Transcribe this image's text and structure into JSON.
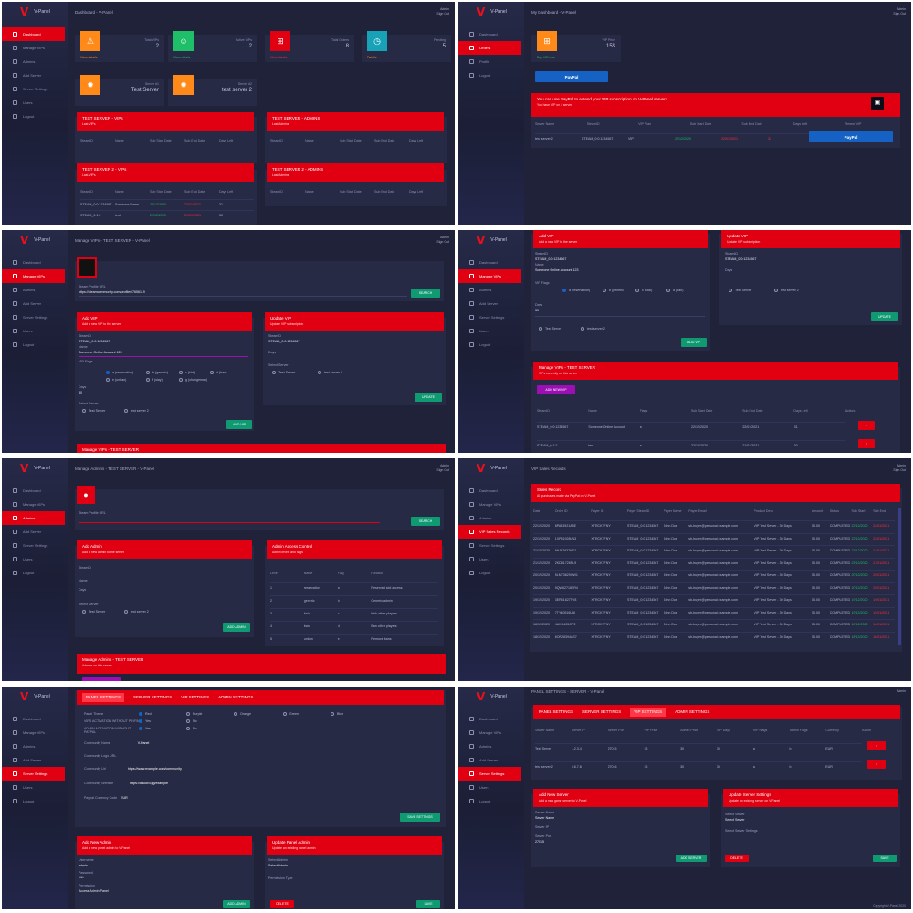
{
  "app": {
    "brand": "V-Panel",
    "user_top": "Admin",
    "user_bottom": "Sign Out"
  },
  "colors": {
    "accent": "#e00012",
    "bg": "#1f2239",
    "sidebar": "#262a48",
    "card": "#262a45",
    "success": "#0f9a72",
    "paypal": "#1662c4",
    "purple": "#9b0fb4"
  },
  "nav_main": [
    "Dashboard",
    "Manage VIPs",
    "Admins",
    "Add Server",
    "Server Settings",
    "Logout",
    "Users"
  ],
  "nav_user": [
    "Dashboard",
    "Orders",
    "Profile",
    "Logout"
  ],
  "p1": {
    "title": "Dashboard - V-Panel",
    "stats": [
      {
        "label": "Total VIPs",
        "value": "2",
        "link": "View details",
        "color": "#ff8a1a",
        "icon": "users-icon"
      },
      {
        "label": "Active VIPs",
        "value": "2",
        "link": "View details",
        "color": "#1fbf6a",
        "icon": "smile-icon"
      },
      {
        "label": "Total Orders",
        "value": "8",
        "link": "View details",
        "color": "#e00012",
        "icon": "cart-icon"
      },
      {
        "label": "Pending",
        "value": "5",
        "link": "Details",
        "color": "#17a2b8",
        "icon": "clock-icon"
      }
    ],
    "servers": [
      {
        "label": "Server #1",
        "value": "Test Server",
        "icon": "gear-icon"
      },
      {
        "label": "Server #2",
        "value": "test server 2",
        "icon": "gear-icon"
      }
    ],
    "tables": [
      {
        "title": "TEST SERVER - VIPs",
        "sub": "Last VIPs",
        "cols": [
          "SteamID",
          "Name",
          "Sub Start Date",
          "Sub End Date",
          "Days Left"
        ],
        "rows": []
      },
      {
        "title": "TEST SERVER - ADMINS",
        "sub": "Last Admins",
        "cols": [
          "SteamID",
          "Name",
          "Sub Start Date",
          "Sub End Date",
          "Days Left"
        ],
        "rows": []
      },
      {
        "title": "TEST SERVER 2 - VIPs",
        "sub": "Last VIPs",
        "cols": [
          "SteamID",
          "Name",
          "Sub Start Date",
          "Sub End Date",
          "Days Left"
        ],
        "rows": [
          [
            "STEAM_0:0:1234567",
            "Someone Name",
            "22/12/2020",
            "22/01/2021",
            "31"
          ],
          [
            "STEAM_0:1:2",
            "test",
            "22/12/2020",
            "21/01/2021",
            "30"
          ]
        ]
      },
      {
        "title": "TEST SERVER 2 - ADMINS",
        "sub": "Last Admins",
        "cols": [
          "SteamID",
          "Name",
          "Sub Start Date",
          "Sub End Date",
          "Days Left"
        ],
        "rows": []
      }
    ]
  },
  "p2": {
    "title": "My Dashboard - V-Panel",
    "stat": {
      "label": "VIP Price",
      "value": "15$",
      "link": "Buy VIP now"
    },
    "paypal": "PayPal",
    "notice": "You can use PayPal to extend your VIP subscription on V-Panel servers",
    "notice_sub": "You have VIP on 1 server",
    "cols": [
      "Server Name",
      "SteamID",
      "VIP Plan",
      "Sub Start Date",
      "Sub End Date",
      "Days Left",
      "Renew VIP"
    ],
    "row": [
      "test server 2",
      "STEAM_0:0:1234567",
      "VIP",
      "22/12/2020",
      "22/01/2021",
      "31",
      "PayPal"
    ]
  },
  "p3": {
    "title": "Manage VIPs - TEST SERVER - V-Panel",
    "profile_label": "Steam Profile URL",
    "profile_value": "https://steamcommunity.com/profiles/7656119",
    "profile_btn": "SEARCH",
    "add_title": "Add VIP",
    "add_sub": "Add a new VIP to the server",
    "update_title": "Update VIP",
    "update_sub": "Update VIP subscription",
    "fields": [
      [
        "SteamID",
        "STEAM_0:0:1234567"
      ],
      [
        "Name",
        "Someone Online Account 123"
      ],
      [
        "Days",
        "30"
      ]
    ],
    "flags_label": "VIP Flags",
    "flags": [
      "a (reservation)",
      "b (generic)",
      "c (kick)",
      "d (ban)",
      "e (unban)",
      "f (slay)",
      "g (changemap)"
    ],
    "servers_label": "Select Server",
    "servers": [
      "Test Server",
      "test server 2"
    ],
    "add_btn": "ADD VIP",
    "update_btn": "UPDATE",
    "bottom_title": "Manage VIPs - TEST SERVER"
  },
  "p4": {
    "title": "Manage VIPs",
    "manage_title": "Manage VIPs - TEST SERVER",
    "manage_sub": "VIPs currently on this server",
    "add_btn": "ADD NEW VIP",
    "cols": [
      "SteamID",
      "Name",
      "Flags",
      "Sub Start Date",
      "Sub End Date",
      "Days Left",
      "Actions"
    ],
    "rows": [
      [
        "STEAM_0:0:1234567",
        "Someone Online Account",
        "a",
        "22/12/2020",
        "22/01/2021",
        "31"
      ],
      [
        "STEAM_0:1:2",
        "test",
        "a",
        "22/12/2020",
        "21/01/2021",
        "30"
      ]
    ]
  },
  "p5": {
    "title": "Manage Admins - TEST SERVER - V-Panel",
    "add_title": "Add Admin",
    "add_sub": "Add a new admin to the server",
    "access_title": "Admin Access Control",
    "access_sub": "Admin levels and flags",
    "access_cols": [
      "Level",
      "Name",
      "Flag",
      "Function"
    ],
    "access_rows": [
      [
        "1",
        "reservation",
        "a",
        "Reserved slot access"
      ],
      [
        "2",
        "generic",
        "b",
        "Generic admin"
      ],
      [
        "3",
        "kick",
        "c",
        "Kick other players"
      ],
      [
        "4",
        "ban",
        "d",
        "Ban other players"
      ],
      [
        "5",
        "unban",
        "e",
        "Remove bans"
      ]
    ],
    "manage_title": "Manage Admins - TEST SERVER",
    "manage_sub": "Admins on this server",
    "btn": "ADD ADMIN"
  },
  "p6": {
    "title": "VIP Sales Records",
    "card_title": "Sales Record",
    "card_sub": "All purchases made via PayPal on V-Panel",
    "cols": [
      "Date",
      "Order ID",
      "Payer ID",
      "Payer SteamID",
      "Payer Name",
      "Payer Email",
      "Product Desc",
      "Amount",
      "Status",
      "Sub Start",
      "Sub End"
    ],
    "rows": [
      [
        "22/12/2020",
        "6PA33921A5E",
        "XTRCK7FNY",
        "STEAM_0:0:1234567",
        "John Doe",
        "sb-buyer@personal.example.com",
        "VIP Test Server - 30 Days",
        "15.00",
        "COMPLETED",
        "22/12/2020",
        "22/01/2021"
      ],
      [
        "22/12/2020",
        "1XP81928LN3",
        "XTRCK7FNY",
        "STEAM_0:0:1234567",
        "John Doe",
        "sb-buyer@personal.example.com",
        "VIP Test Server - 30 Days",
        "15.00",
        "COMPLETED",
        "22/12/2020",
        "22/01/2021"
      ],
      [
        "21/12/2020",
        "8HJ92837KS2",
        "XTRCK7FNY",
        "STEAM_0:0:1234567",
        "John Doe",
        "sb-buyer@personal.example.com",
        "VIP Test Server - 30 Days",
        "15.00",
        "COMPLETED",
        "21/12/2020",
        "21/01/2021"
      ],
      [
        "21/12/2020",
        "2KD81726PL9",
        "XTRCK7FNY",
        "STEAM_0:0:1234567",
        "John Doe",
        "sb-buyer@personal.example.com",
        "VIP Test Server - 30 Days",
        "15.00",
        "COMPLETED",
        "21/12/2020",
        "21/01/2021"
      ],
      [
        "20/12/2020",
        "5LM73829QW1",
        "XTRCK7FNY",
        "STEAM_0:0:1234567",
        "John Doe",
        "sb-buyer@personal.example.com",
        "VIP Test Server - 30 Days",
        "15.00",
        "COMPLETED",
        "20/12/2020",
        "20/01/2021"
      ],
      [
        "20/12/2020",
        "9QW62718ER4",
        "XTRCK7FNY",
        "STEAM_0:0:1234567",
        "John Doe",
        "sb-buyer@personal.example.com",
        "VIP Test Server - 30 Days",
        "15.00",
        "COMPLETED",
        "20/12/2020",
        "20/01/2021"
      ],
      [
        "19/12/2020",
        "3ER51627TY8",
        "XTRCK7FNY",
        "STEAM_0:0:1234567",
        "John Doe",
        "sb-buyer@personal.example.com",
        "VIP Test Server - 30 Days",
        "15.00",
        "COMPLETED",
        "19/12/2020",
        "19/01/2021"
      ],
      [
        "19/12/2020",
        "7TY40516UI6",
        "XTRCK7FNY",
        "STEAM_0:0:1234567",
        "John Doe",
        "sb-buyer@personal.example.com",
        "VIP Test Server - 30 Days",
        "15.00",
        "COMPLETED",
        "19/12/2020",
        "19/01/2021"
      ],
      [
        "18/12/2020",
        "4UI39405OP2",
        "XTRCK7FNY",
        "STEAM_0:0:1234567",
        "John Doe",
        "sb-buyer@personal.example.com",
        "VIP Test Server - 30 Days",
        "15.00",
        "COMPLETED",
        "18/12/2020",
        "18/01/2021"
      ],
      [
        "18/12/2020",
        "6OP28394AS7",
        "XTRCK7FNY",
        "STEAM_0:0:1234567",
        "John Doe",
        "sb-buyer@personal.example.com",
        "VIP Test Server - 30 Days",
        "15.00",
        "COMPLETED",
        "18/12/2020",
        "18/01/2021"
      ]
    ]
  },
  "p7": {
    "tabs": [
      "PANEL SETTINGS",
      "SERVER SETTINGS",
      "VIP SETTINGS",
      "ADMIN SETTINGS"
    ],
    "opts_row1": [
      "Red",
      "Purple",
      "Orange",
      "Green",
      "Blue"
    ],
    "opt_labels": [
      "Panel Theme",
      "VIPS ACTIVATION WITHOUT PAYPAL",
      "ADMIN ACTIVATION WITHOUT PAYPAL"
    ],
    "yes": "Yes",
    "no": "No",
    "fields": [
      [
        "Community Name",
        "V-Panel"
      ],
      [
        "Community Logo URL",
        ""
      ],
      [
        "Community Url",
        "https://www.example.com/community"
      ],
      [
        "Community Website",
        "https://discord.gg/example"
      ],
      [
        "Paypal Currency Code",
        "EUR"
      ]
    ],
    "save_btn": "SAVE SETTINGS",
    "add_title": "Add New Admin",
    "add_sub": "Add a new panel admin to V-Panel",
    "update_title": "Update Panel Admin",
    "update_sub": "Update an existing panel admin",
    "add_fields": [
      [
        "Username",
        "admin"
      ],
      [
        "Password",
        "****"
      ],
      [
        "Permission",
        "Access Admin Panel"
      ]
    ],
    "update_fields": [
      [
        "Select Admin",
        "Select Admin"
      ],
      [
        "Permission Type",
        ""
      ]
    ],
    "btn_add": "ADD ADMIN",
    "btn_delete": "DELETE",
    "btn_save": "SAVE"
  },
  "p8": {
    "title": "PANEL SETTINGS - SERVER - V-Panel",
    "tabs": [
      "PANEL SETTINGS",
      "SERVER SETTINGS",
      "VIP SETTINGS",
      "ADMIN SETTINGS"
    ],
    "cols": [
      "Server Name",
      "Server IP",
      "Server Port",
      "VIP Price",
      "Admin Price",
      "VIP Days",
      "VIP Flags",
      "Admin Flags",
      "Currency",
      "Action"
    ],
    "rows": [
      [
        "Test Server",
        "1.2.3.4",
        "27015",
        "15",
        "30",
        "30",
        "a",
        "b",
        "EUR"
      ],
      [
        "test server 2",
        "5.6.7.8",
        "27016",
        "15",
        "30",
        "30",
        "a",
        "b",
        "EUR"
      ]
    ],
    "add_title": "Add New Server",
    "add_sub": "Add a new game server to V-Panel",
    "update_title": "Update Server Settings",
    "update_sub": "Update an existing server on V-Panel",
    "add_fields": [
      [
        "Server Name",
        "Server Name"
      ],
      [
        "Server IP",
        ""
      ],
      [
        "Server Port",
        "27015"
      ]
    ],
    "update_fields": [
      [
        "Select Server",
        "Select Server"
      ],
      [
        "Select Server Settings",
        ""
      ]
    ],
    "btn_add": "ADD SERVER",
    "btn_delete": "DELETE",
    "btn_save": "SAVE",
    "footer": "Copyright V-Panel 2020"
  }
}
